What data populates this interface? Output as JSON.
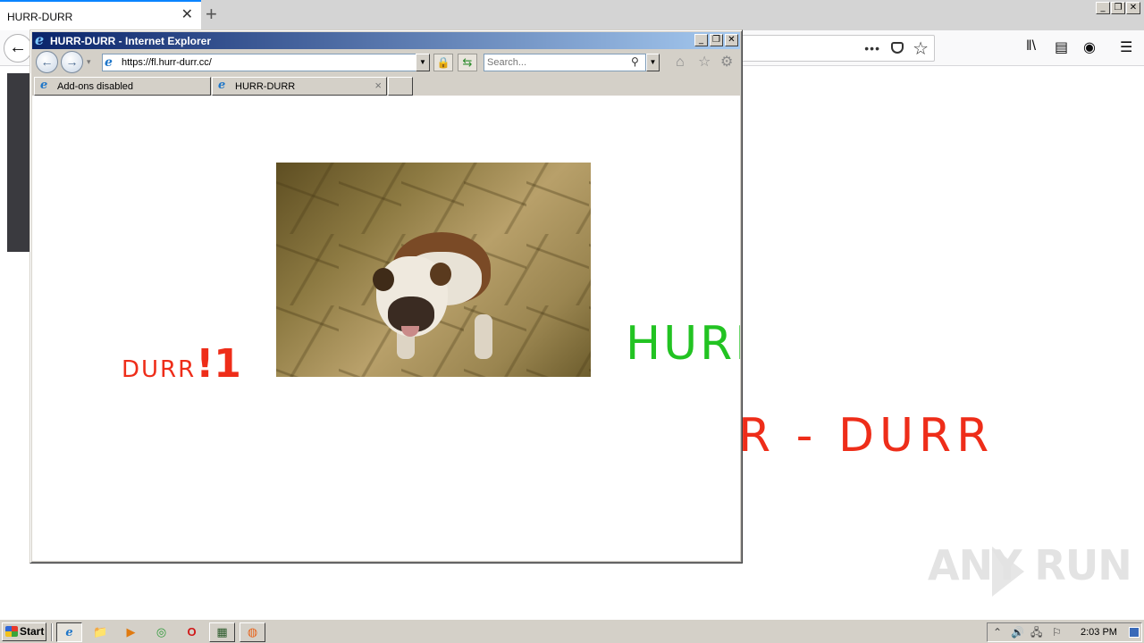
{
  "firefox": {
    "tab_title": "HURR-DURR",
    "tab_close": "✕",
    "new_tab": "+",
    "back": "←",
    "url_dots": "•••",
    "bookmark_star": "☆",
    "library": "ǁ\\",
    "sidebar": "▤",
    "account": "◉",
    "menu": "☰",
    "page_text": "R - DURR"
  },
  "window_buttons": {
    "minimize": "_",
    "restore": "❐",
    "close": "✕"
  },
  "ie": {
    "title": "HURR-DURR - Internet Explorer",
    "title_icon": "e",
    "back": "←",
    "forward": "→",
    "nav_dropdown": "▾",
    "address": "https://fl.hurr-durr.cc/",
    "address_dropdown": "▼",
    "lock": "🔒",
    "refresh": "⇆",
    "search_placeholder": "Search...",
    "search_icon": "⚲",
    "search_dropdown": "▼",
    "home": "⌂",
    "favorites": "☆",
    "tools": "⚙",
    "tabs": [
      {
        "label": "Add-ons disabled",
        "closable": false
      },
      {
        "label": "HURR-DURR",
        "closable": true,
        "close": "×"
      }
    ],
    "content": {
      "durr_small": "DURR",
      "durr_big": "!1",
      "hurr": "HURR"
    }
  },
  "taskbar": {
    "start_label": "Start",
    "apps": [
      {
        "name": "internet-explorer",
        "glyph": "e"
      },
      {
        "name": "file-explorer",
        "glyph": "📁"
      },
      {
        "name": "media-player",
        "glyph": "▶"
      },
      {
        "name": "chrome",
        "glyph": "◎"
      },
      {
        "name": "opera",
        "glyph": "O"
      },
      {
        "name": "task-manager",
        "glyph": "▦"
      },
      {
        "name": "firefox",
        "glyph": "◍"
      }
    ],
    "tray": {
      "show_hidden": "⌃",
      "volume": "🔊",
      "network": "🖧",
      "flag": "⚐",
      "clock": "2:03 PM"
    }
  },
  "watermark": "ANY  RUN",
  "colors": {
    "durr_red": "#ee2d19",
    "hurr_green": "#22c322",
    "ie_title_start": "#0a246a",
    "ie_title_end": "#a6caf0",
    "classic_gray": "#d4d0c8"
  }
}
